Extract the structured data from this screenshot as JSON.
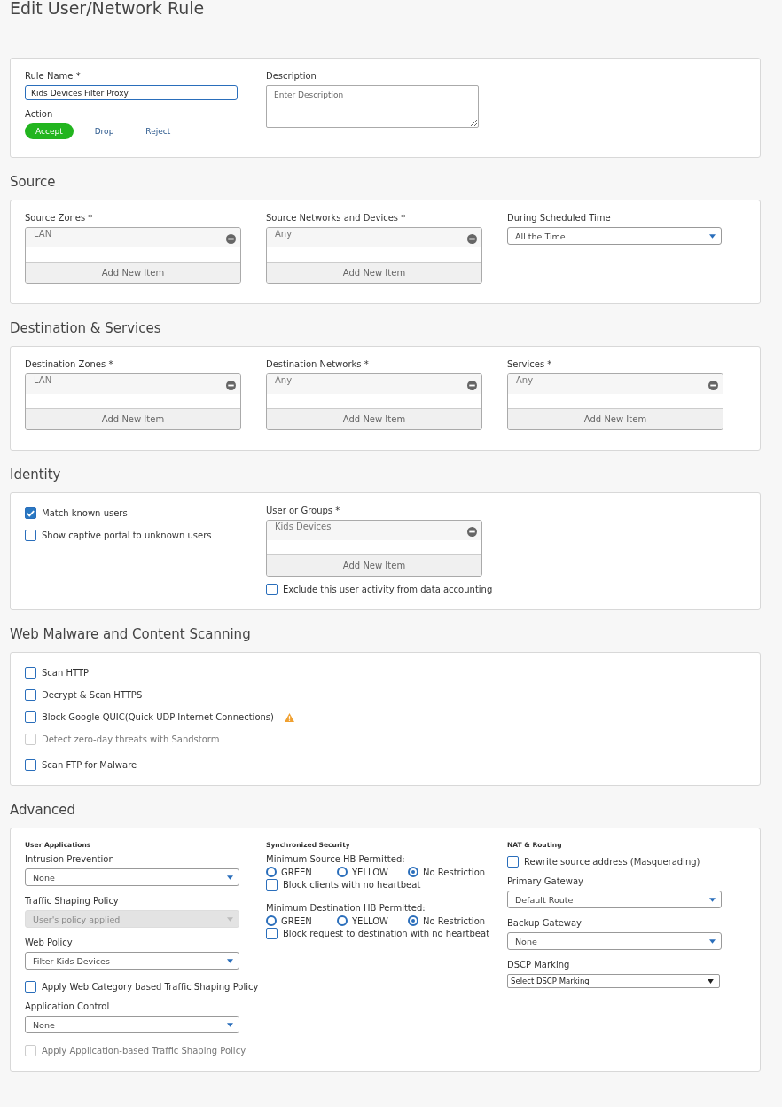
{
  "title": "Edit User/Network Rule",
  "general": {
    "rule_name": {
      "label": "Rule Name *",
      "value": "Kids Devices Filter Proxy"
    },
    "description": {
      "label": "Description",
      "placeholder": "Enter Description"
    },
    "action": {
      "label": "Action",
      "options": [
        {
          "label": "Accept",
          "selected": true
        },
        {
          "label": "Drop",
          "selected": false
        },
        {
          "label": "Reject",
          "selected": false
        }
      ]
    }
  },
  "sections": [
    {
      "heading": "Source",
      "columns": [
        [
          [
            {
              "kind": "list",
              "label": "Source Zones *",
              "item": "LAN",
              "add": "Add New Item"
            }
          ]
        ],
        [
          [
            {
              "kind": "list",
              "label": "Source Networks and Devices *",
              "item": "Any",
              "add": "Add New Item"
            }
          ]
        ],
        [
          [
            {
              "kind": "select",
              "label": "During Scheduled Time",
              "value": "All the Time",
              "disabled": false
            }
          ]
        ]
      ]
    },
    {
      "heading": "Destination & Services",
      "columns": [
        [
          [
            {
              "kind": "list",
              "label": "Destination Zones *",
              "item": "LAN",
              "add": "Add New Item"
            }
          ]
        ],
        [
          [
            {
              "kind": "list",
              "label": "Destination Networks *",
              "item": "Any",
              "add": "Add New Item"
            }
          ]
        ],
        [
          [
            {
              "kind": "list",
              "label": "Services *",
              "item": "Any",
              "add": "Add New Item"
            }
          ]
        ]
      ]
    },
    {
      "heading": "Identity",
      "columns": [
        [
          [
            {
              "kind": "checkbox",
              "label": "Match known users",
              "checked": true,
              "disabled": false
            },
            {
              "kind": "checkbox",
              "label": "Show captive portal to unknown users",
              "checked": false,
              "disabled": false
            }
          ]
        ],
        [
          [
            {
              "kind": "list",
              "label": "User or Groups *",
              "item": "Kids Devices",
              "add": "Add New Item"
            },
            {
              "kind": "checkbox",
              "label": "Exclude this user activity from data accounting",
              "checked": false,
              "disabled": false
            }
          ]
        ]
      ]
    },
    {
      "heading": "Web Malware and Content Scanning",
      "columns": [
        [
          [
            {
              "kind": "checkbox",
              "label": "Scan HTTP",
              "checked": false,
              "disabled": false
            },
            {
              "kind": "checkbox",
              "label": "Decrypt & Scan HTTPS",
              "checked": false,
              "disabled": false
            },
            {
              "kind": "checkbox-warning",
              "label": "Block Google QUIC(Quick UDP Internet Connections)",
              "checked": false,
              "disabled": false
            },
            {
              "kind": "checkbox",
              "label": "Detect zero-day threats with Sandstorm",
              "checked": false,
              "disabled": true
            }
          ],
          [
            {
              "kind": "checkbox",
              "label": "Scan FTP for Malware",
              "checked": false,
              "disabled": false
            }
          ]
        ]
      ]
    },
    {
      "heading": "Advanced",
      "columns": [
        [
          [
            {
              "kind": "subhead",
              "label": "User Applications"
            },
            {
              "kind": "select",
              "label": "Intrusion Prevention",
              "value": "None",
              "disabled": false
            },
            {
              "kind": "select",
              "label": "Traffic Shaping Policy",
              "value": "User's policy applied",
              "disabled": true
            },
            {
              "kind": "select",
              "label": "Web Policy",
              "value": "Filter Kids Devices",
              "disabled": false
            },
            {
              "kind": "checkbox",
              "label": "Apply Web Category based Traffic Shaping Policy",
              "checked": false,
              "disabled": false
            },
            {
              "kind": "select",
              "label": "Application Control",
              "value": "None",
              "disabled": false
            },
            {
              "kind": "checkbox",
              "label": "Apply Application-based Traffic Shaping Policy",
              "checked": false,
              "disabled": true
            }
          ]
        ],
        [
          [
            {
              "kind": "subhead",
              "label": "Synchronized Security"
            },
            {
              "kind": "radios",
              "label": "Minimum Source HB Permitted:",
              "options": [
                {
                  "label": "GREEN",
                  "selected": false
                },
                {
                  "label": "YELLOW",
                  "selected": false
                },
                {
                  "label": "No Restriction",
                  "selected": true
                }
              ]
            },
            {
              "kind": "checkbox",
              "label": "Block clients with no heartbeat",
              "checked": false,
              "disabled": false
            }
          ],
          [
            {
              "kind": "radios",
              "label": "Minimum Destination HB Permitted:",
              "options": [
                {
                  "label": "GREEN",
                  "selected": false
                },
                {
                  "label": "YELLOW",
                  "selected": false
                },
                {
                  "label": "No Restriction",
                  "selected": true
                }
              ]
            },
            {
              "kind": "checkbox",
              "label": "Block request to destination with no heartbeat",
              "checked": false,
              "disabled": false
            }
          ]
        ],
        [
          [
            {
              "kind": "subhead",
              "label": "NAT & Routing"
            },
            {
              "kind": "checkbox",
              "label": "Rewrite source address (Masquerading)",
              "checked": false,
              "disabled": false
            },
            {
              "kind": "select",
              "label": "Primary Gateway",
              "value": "Default Route",
              "disabled": false
            },
            {
              "kind": "select",
              "label": "Backup Gateway",
              "value": "None",
              "disabled": false
            },
            {
              "kind": "plain-select",
              "label": "DSCP Marking",
              "value": "Select DSCP Marking"
            }
          ]
        ]
      ]
    }
  ]
}
